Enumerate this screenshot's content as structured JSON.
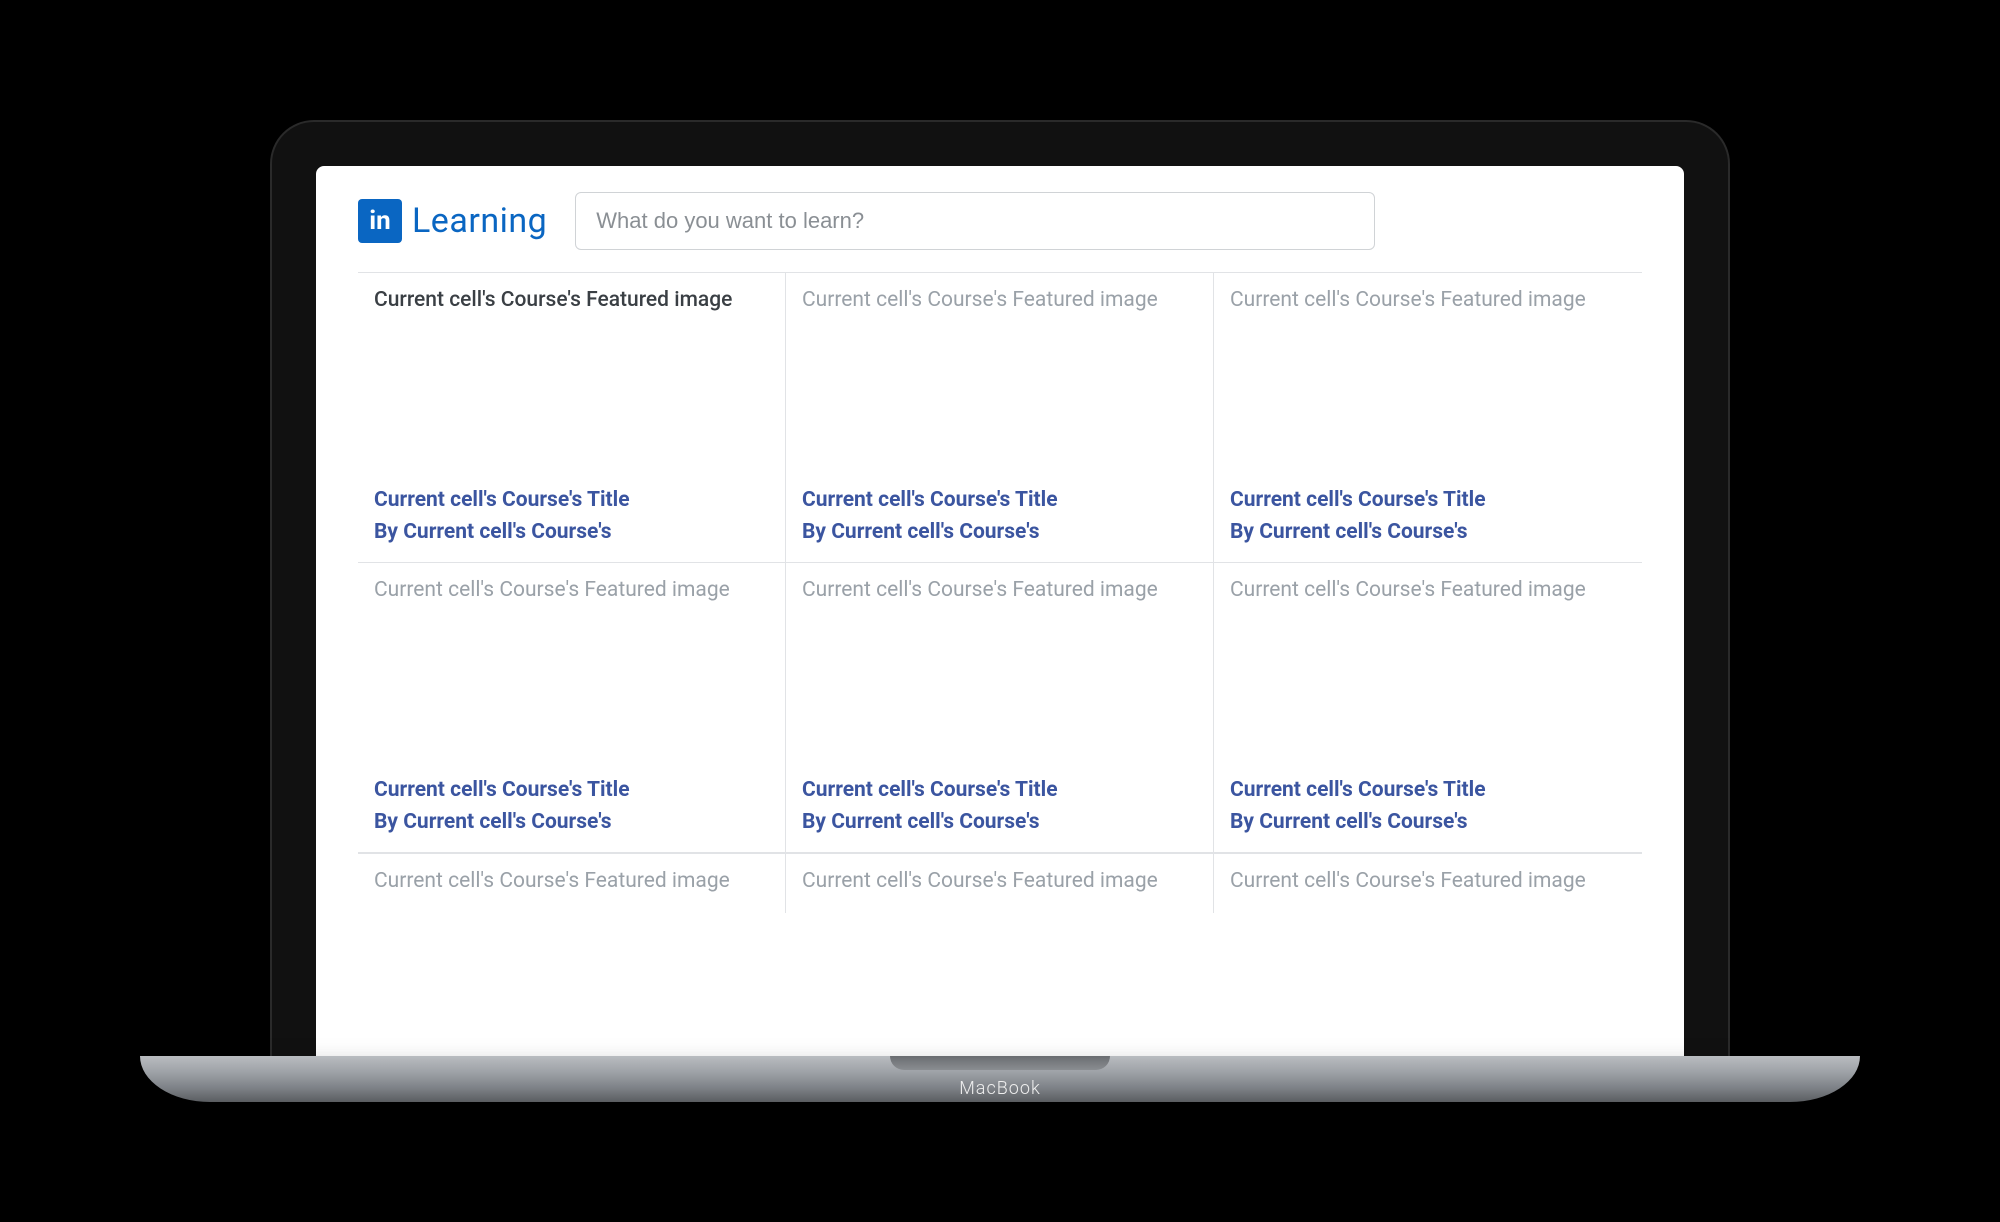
{
  "header": {
    "logo_badge": "in",
    "logo_text": "Learning",
    "search_placeholder": "What do you want to learn?"
  },
  "device": {
    "label": "MacBook"
  },
  "grid": {
    "rows": [
      {
        "cells": [
          {
            "featured": "Current cell's Course's Featured image",
            "title": "Current cell's Course's Title",
            "author": "By Current cell's Course's"
          },
          {
            "featured": "Current cell's Course's Featured image",
            "title": "Current cell's Course's Title",
            "author": "By Current cell's Course's"
          },
          {
            "featured": "Current cell's Course's Featured image",
            "title": "Current cell's Course's Title",
            "author": "By Current cell's Course's"
          }
        ]
      },
      {
        "cells": [
          {
            "featured": "Current cell's Course's Featured image",
            "title": "Current cell's Course's Title",
            "author": "By Current cell's Course's"
          },
          {
            "featured": "Current cell's Course's Featured image",
            "title": "Current cell's Course's Title",
            "author": "By Current cell's Course's"
          },
          {
            "featured": "Current cell's Course's Featured image",
            "title": "Current cell's Course's Title",
            "author": "By Current cell's Course's"
          }
        ]
      },
      {
        "cells": [
          {
            "featured": "Current cell's Course's Featured image"
          },
          {
            "featured": "Current cell's Course's Featured image"
          },
          {
            "featured": "Current cell's Course's Featured image"
          }
        ]
      }
    ]
  }
}
